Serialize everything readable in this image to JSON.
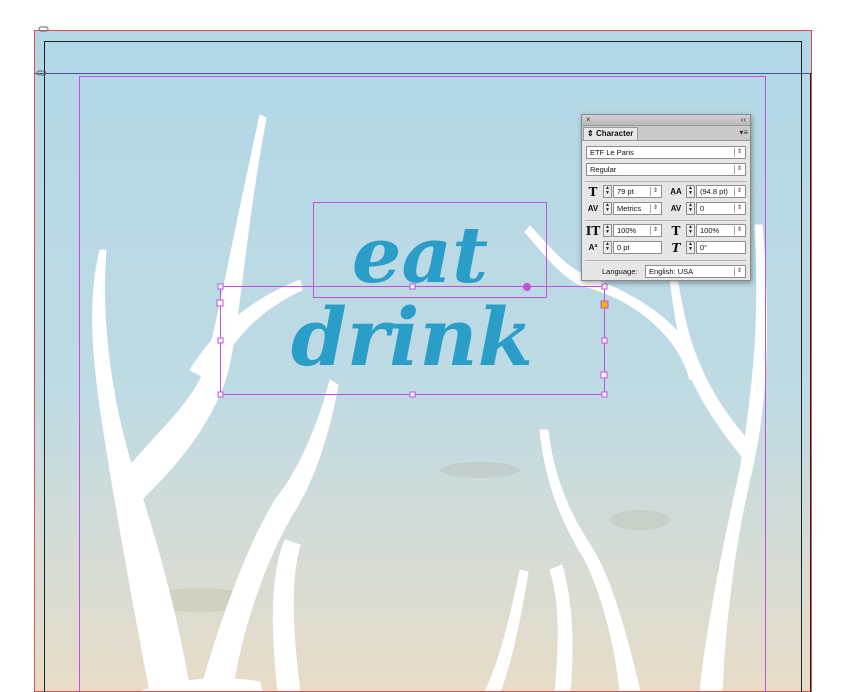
{
  "document": {
    "headline_line1": "eat",
    "headline_line2": "drink",
    "colors": {
      "sky_top": "#b2d7e6",
      "sky_bottom": "#e8dcc8",
      "text_blue": "#2a9ec8",
      "antler": "#ffffff",
      "frame_selection": "#c24fe0",
      "page_edge": "#222222",
      "bleed_guide": "#e04a4a",
      "guide_line": "#4a4aa0",
      "anchor_handle": "#f4b400"
    }
  },
  "character_panel": {
    "close_glyph": "×",
    "collapse_glyph": "‹‹",
    "menu_glyph": "▾≡",
    "tab_label": "Character",
    "font_family": "ETF Le Paris",
    "font_style": "Regular",
    "font_size": "79 pt",
    "leading": "(94.8 pt)",
    "kerning": "Metrics",
    "tracking": "0",
    "vertical_scale": "100%",
    "horizontal_scale": "100%",
    "baseline_shift": "0 pt",
    "skew": "0°",
    "language_label": "Language:",
    "language": "English: USA",
    "icons": {
      "font_size": "font-size-icon",
      "leading": "leading-icon",
      "kerning": "kerning-icon",
      "tracking": "tracking-icon",
      "vertical_scale": "vertical-scale-icon",
      "horizontal_scale": "horizontal-scale-icon",
      "baseline_shift": "baseline-shift-icon",
      "skew": "skew-icon"
    }
  }
}
